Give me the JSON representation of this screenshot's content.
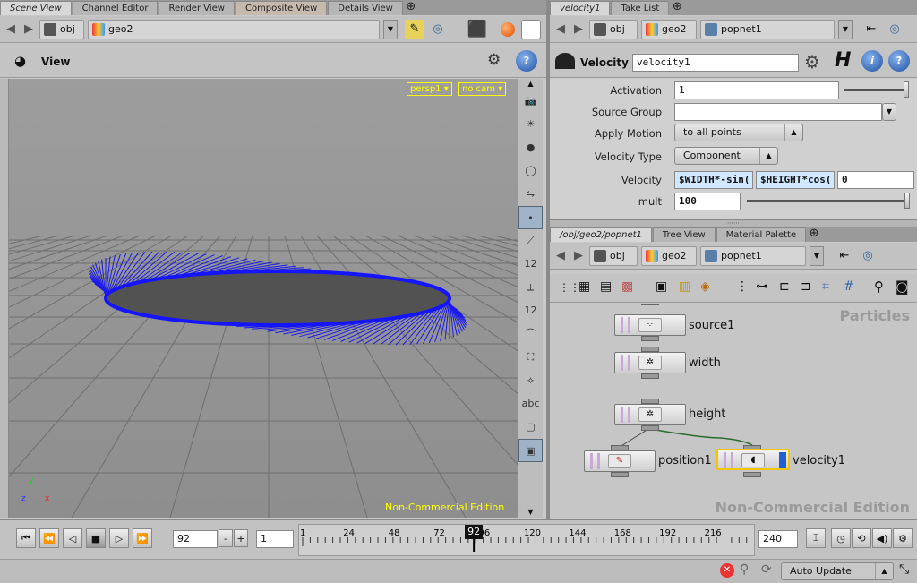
{
  "left_tabs": [
    "Scene View",
    "Channel Editor",
    "Render View",
    "Composite View",
    "Details View"
  ],
  "left_path": {
    "root": "obj",
    "node": "geo2"
  },
  "viewer": {
    "title": "View",
    "camera_menu": "persp1",
    "cam_menu": "no cam",
    "watermark": "Non-Commercial Edition",
    "axis_x": "x",
    "axis_y": "y",
    "axis_z": "z"
  },
  "right_top_tabs": [
    "velocity1",
    "Take List"
  ],
  "right_top_path": {
    "root": "obj",
    "node": "geo2",
    "child": "popnet1"
  },
  "params": {
    "node_type": "Velocity",
    "node_name": "velocity1",
    "activation_label": "Activation",
    "activation_value": "1",
    "source_group_label": "Source Group",
    "source_group_value": "",
    "apply_motion_label": "Apply Motion",
    "apply_motion_value": "to all points",
    "velocity_type_label": "Velocity Type",
    "velocity_type_value": "Component",
    "velocity_label": "Velocity",
    "velocity_x": "$WIDTH*-sin(",
    "velocity_y": "$HEIGHT*cos(",
    "velocity_z": "0",
    "mult_label": "mult",
    "mult_value": "100",
    "activation_slider": 1.0,
    "mult_slider": 1.0
  },
  "network_tabs": [
    "/obj/geo2/popnet1",
    "Tree View",
    "Material Palette"
  ],
  "network_path": {
    "root": "obj",
    "node": "geo2",
    "child": "popnet1"
  },
  "network": {
    "context_label": "Particles",
    "watermark": "Non-Commercial Edition",
    "nodes": [
      "source1",
      "width",
      "height",
      "position1",
      "velocity1"
    ]
  },
  "timeline": {
    "current_frame": "92",
    "step": "1",
    "end_frame": "240",
    "playhead_label": "92",
    "ticks": [
      "1",
      "24",
      "48",
      "72",
      "96",
      "120",
      "144",
      "168",
      "192",
      "216"
    ],
    "minus": "-",
    "plus": "+"
  },
  "status": {
    "update_mode": "Auto Update"
  }
}
